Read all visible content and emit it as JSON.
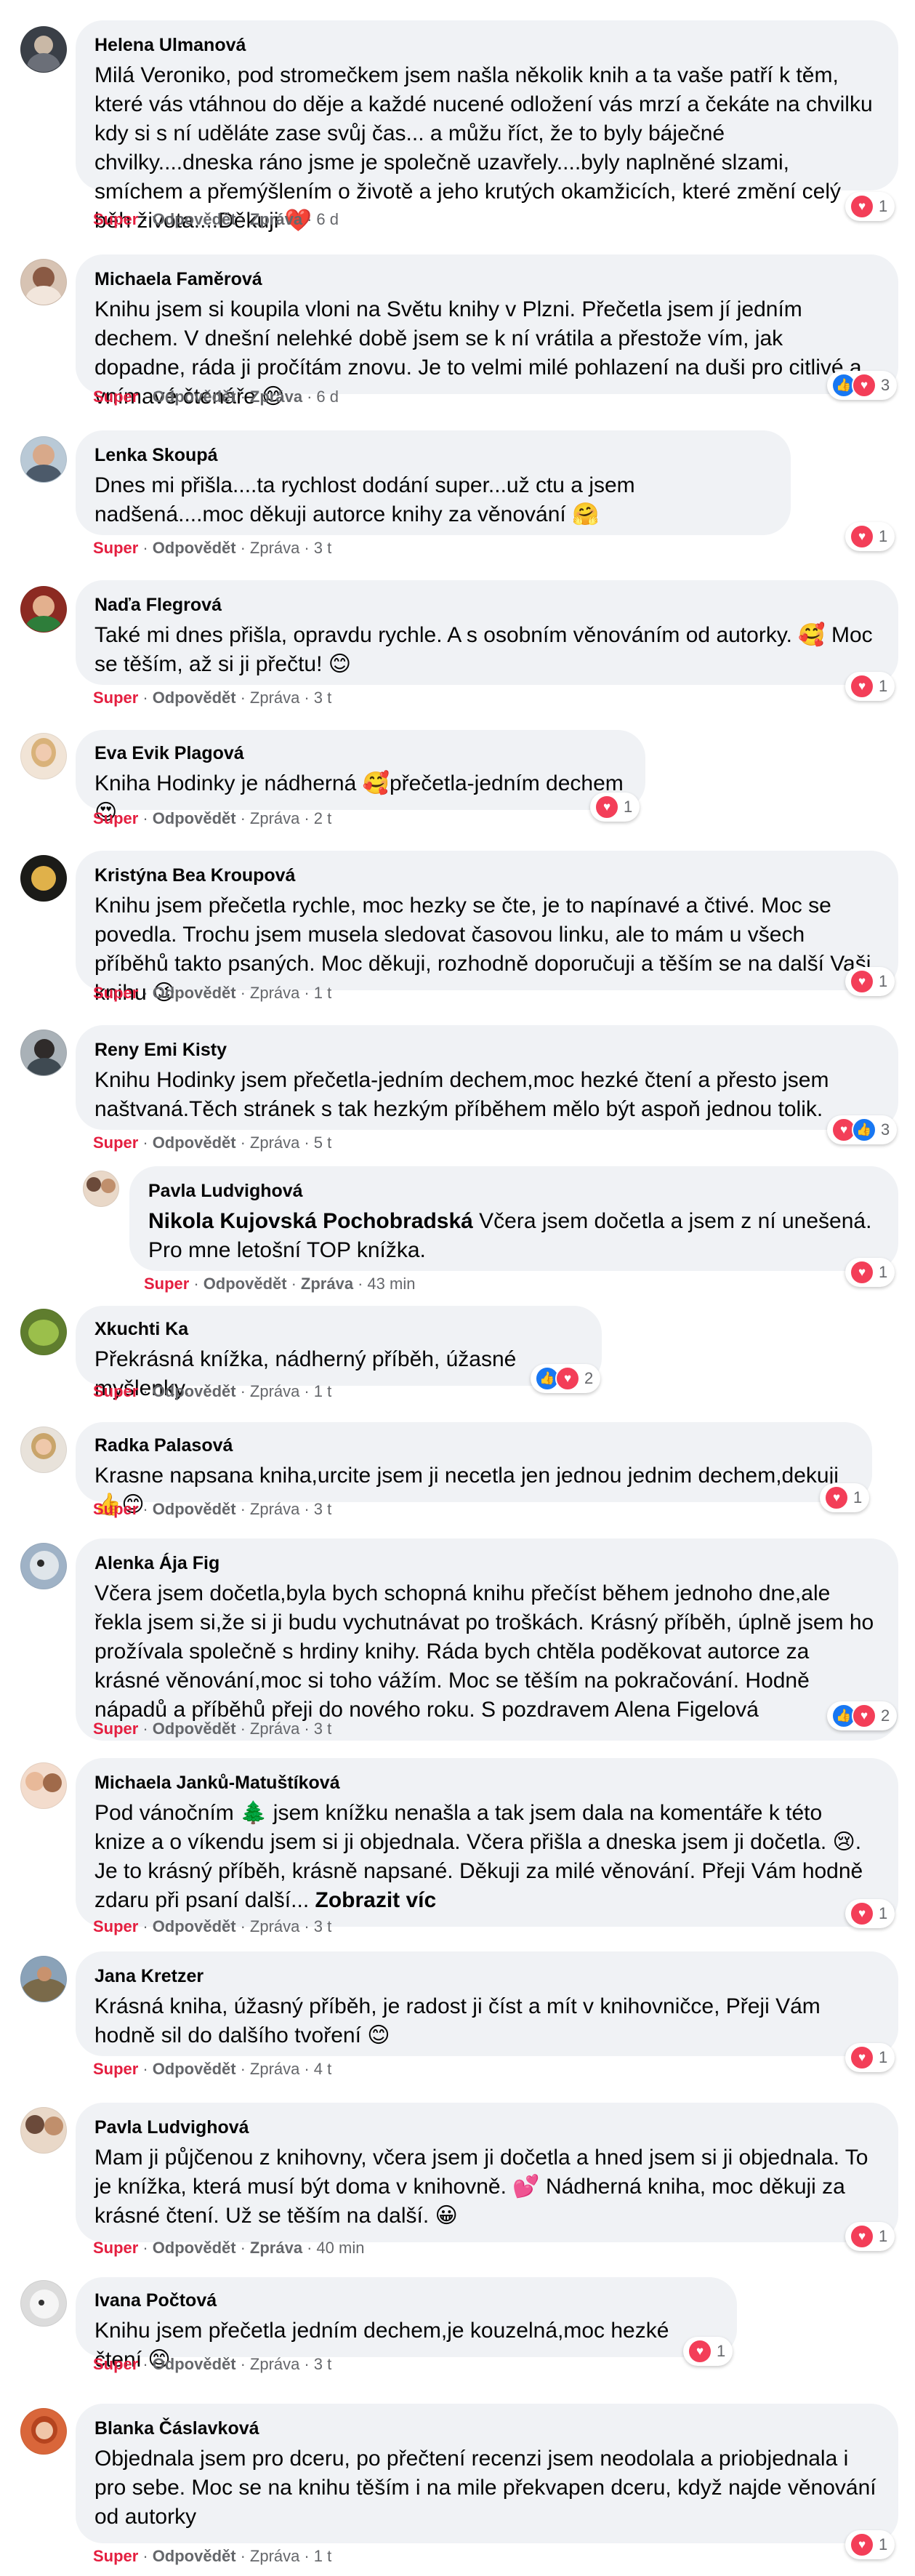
{
  "ui": {
    "like_label": "Super",
    "reply_label": "Odpovědět",
    "message_label": "Zpráva",
    "see_more_label": "Zobrazit víc",
    "separator": "·"
  },
  "colors": {
    "bubble_bg": "#f0f2f5",
    "like_red": "#e41e3f",
    "meta_gray": "#65676b",
    "love_reaction": "#f33e58",
    "like_reaction": "#1877f2"
  },
  "comments": [
    {
      "author": "Helena Ulmanová",
      "text": "Milá Veroniko, pod stromečkem jsem našla několik knih a ta vaše patří k těm, které vás vtáhnou do děje a každé nucené odložení vás mrzí a čekáte na chvilku kdy si s ní uděláte zase svůj čas... a můžu říct, že to byly báječné chvilky....dneska ráno jsme je společně uzavřely....byly naplněné slzami, smíchem a přemýšlením o životě a jeho krutých okamžicích, které změní celý běh života....Děkuji ❤️",
      "time": "6 d",
      "reactions": [
        "heart-reaction-icon"
      ],
      "reaction_count": "1"
    },
    {
      "author": "Michaela Faměrová",
      "text": "Knihu jsem si koupila vloni na Světu knihy v Plzni. Přečetla jsem jí jedním dechem. V dnešní nelehké době jsem se k ní vrátila a přestože vím, jak dopadne, ráda ji pročítám znovu. Je to velmi milé pohlazení na duši pro citlivé a vnímavé čtenáře 😊",
      "time": "6 d",
      "reactions": [
        "like-reaction-icon",
        "heart-reaction-icon"
      ],
      "reaction_count": "3"
    },
    {
      "author": "Lenka Skoupá",
      "text": "Dnes mi přišla....ta rychlost dodání super...už ctu a jsem nadšená....moc děkuji autorce knihy za věnování 🤗",
      "time": "3 t",
      "reactions": [
        "heart-reaction-icon"
      ],
      "reaction_count": "1"
    },
    {
      "author": "Naďa Flegrová",
      "text": "Také mi dnes přišla, opravdu rychle. A s osobním věnováním od autorky. 🥰 Moc se těším, až si ji přečtu! 😊",
      "time": "3 t",
      "reactions": [
        "heart-reaction-icon"
      ],
      "reaction_count": "1"
    },
    {
      "author": "Eva Evik Plagová",
      "text": "Kniha Hodinky je nádherná 🥰přečetla-jedním dechem😍",
      "time": "2 t",
      "reactions": [
        "heart-reaction-icon"
      ],
      "reaction_count": "1"
    },
    {
      "author": "Kristýna Bea Kroupová",
      "text": "Knihu jsem přečetla rychle, moc hezky se čte, je to napínavé a čtivé. Moc se povedla. Trochu jsem musela sledovat časovou linku, ale to mám u všech příběhů takto psaných. Moc děkuji, rozhodně doporučuji a těším se na další Vaši knihu 😉",
      "time": "1 t",
      "reactions": [
        "heart-reaction-icon"
      ],
      "reaction_count": "1"
    },
    {
      "author": "Reny Emi Kisty",
      "text": "Knihu Hodinky jsem přečetla-jedním dechem,moc hezké čtení a přesto jsem naštvaná.Těch stránek s tak hezkým příběhem mělo být aspoň jednou tolik.",
      "time": "5 t",
      "reactions": [
        "heart-reaction-icon",
        "like-reaction-icon"
      ],
      "reaction_count": "3"
    },
    {
      "author": "Pavla Ludvighová",
      "mention": "Nikola Kujovská Pochobradská",
      "text": " Včera jsem dočetla a jsem z ní unešená. Pro mne letošní TOP knížka.",
      "time": "43 min",
      "reactions": [
        "heart-reaction-icon"
      ],
      "reaction_count": "1"
    },
    {
      "author": "Xkuchti Ka",
      "text": "Překrásná knížka, nádherný příběh, úžasné myšlenky.",
      "time": "1 t",
      "reactions": [
        "like-reaction-icon",
        "heart-reaction-icon"
      ],
      "reaction_count": "2"
    },
    {
      "author": "Radka Palasová",
      "text": "Krasne napsana kniha,urcite jsem ji necetla jen jednou jednim dechem,dekuji👍😊",
      "time": "3 t",
      "reactions": [
        "heart-reaction-icon"
      ],
      "reaction_count": "1"
    },
    {
      "author": "Alenka Ája Fig",
      "text": "Včera jsem dočetla,byla bych schopná knihu přečíst během jednoho dne,ale řekla jsem si,že si ji budu vychutnávat po troškách. Krásný příběh, úplně jsem ho prožívala společně s hrdiny knihy. Ráda bych chtěla poděkovat autorce za krásné věnování,moc si toho vážím. Moc se těším na pokračování. Hodně nápadů a příběhů přeji do nového roku. S pozdravem Alena Figelová",
      "time": "3 t",
      "reactions": [
        "like-reaction-icon",
        "heart-reaction-icon"
      ],
      "reaction_count": "2"
    },
    {
      "author": "Michaela Janků-Matuštíková",
      "text": "Pod vánočním 🌲 jsem knížku nenašla a tak jsem dala na komentáře k této knize a o víkendu jsem si ji objednala. Včera přišla a dneska jsem ji dočetla. 😢. Je to krásný příběh, krásně napsané. Děkuji za milé věnování. Přeji Vám hodně zdaru při psaní další... ",
      "time": "3 t",
      "reactions": [
        "heart-reaction-icon"
      ],
      "reaction_count": "1"
    },
    {
      "author": "Jana Kretzer",
      "text": "Krásná kniha, úžasný příběh, je radost ji číst a mít v knihovničce, Přeji Vám hodně sil do dalšího tvoření 😊",
      "time": "4 t",
      "reactions": [
        "heart-reaction-icon"
      ],
      "reaction_count": "1"
    },
    {
      "author": "Pavla Ludvighová",
      "text": "Mam ji půjčenou z knihovny, včera jsem ji dočetla a hned jsem si ji objednala. To je knížka, která musí být doma v knihovně. 💕 Nádherná kniha, moc děkuji za krásné čtení. Už se těším na další. 😀",
      "time": "40 min",
      "reactions": [
        "heart-reaction-icon"
      ],
      "reaction_count": "1"
    },
    {
      "author": "Ivana Počtová",
      "text": "Knihu jsem přečetla jedním dechem,je kouzelná,moc hezké čtení 😊",
      "time": "3 t",
      "reactions": [
        "heart-reaction-icon"
      ],
      "reaction_count": "1"
    },
    {
      "author": "Blanka Čáslavková",
      "text": "Objednala jsem pro dceru, po přečtení recenzi jsem neodolala a priobjednala i pro sebe. Moc se na knihu těším i na mile překvapen dceru, když najde věnování od autorky",
      "time": "1 t",
      "reactions": [
        "heart-reaction-icon"
      ],
      "reaction_count": "1"
    }
  ]
}
